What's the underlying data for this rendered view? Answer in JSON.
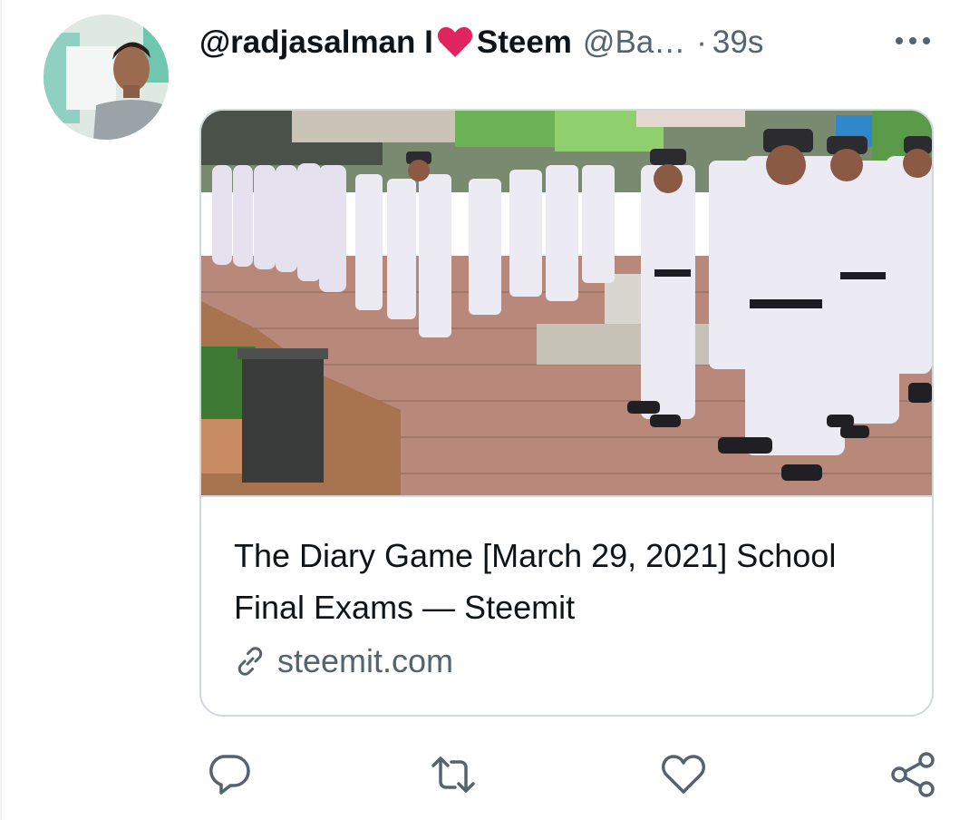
{
  "tweet": {
    "display_name": "@radjasalman I",
    "display_name_after_heart": "Steem",
    "handle": "@Ba…",
    "separator": "·",
    "time": "39s"
  },
  "card": {
    "title": "The Diary Game [March 29, 2021] School Final Exams — Steemit",
    "domain": "steemit.com"
  },
  "icons": {
    "avatar": "avatar-photo",
    "heart": "red-heart-emoji",
    "more": "more-dots-icon",
    "link": "link-icon",
    "reply": "reply-icon",
    "retweet": "retweet-icon",
    "like": "like-heart-icon",
    "share": "share-icon"
  },
  "colors": {
    "text": "#0f1419",
    "secondary": "#536471",
    "border": "#cfd9de",
    "heart": "#e0245e"
  }
}
